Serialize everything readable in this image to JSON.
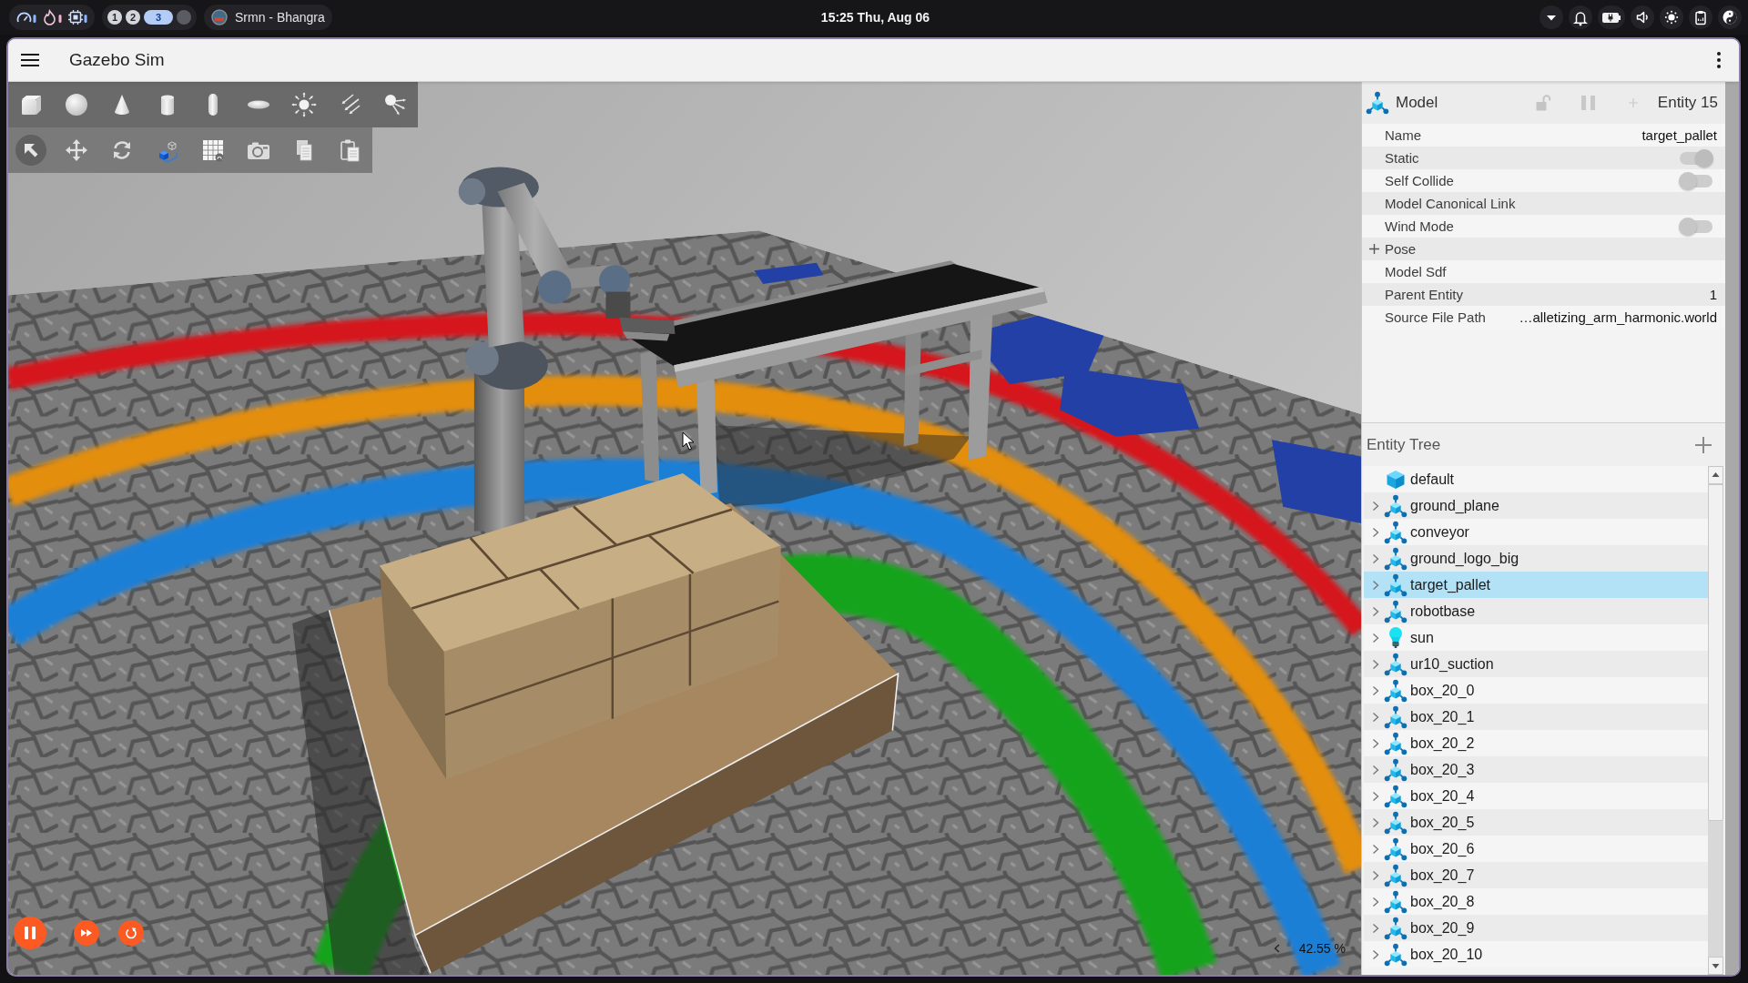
{
  "system_bar": {
    "workspaces": [
      {
        "label": "1",
        "kind": "occupied",
        "selected": false
      },
      {
        "label": "2",
        "kind": "occupied",
        "selected": false
      },
      {
        "label": "3",
        "kind": "occupied",
        "selected": true
      },
      {
        "kind": "empty",
        "selected": false
      }
    ],
    "media": {
      "title": "Srmn - Bhangra"
    },
    "clock": "15:25 Thu, Aug 06"
  },
  "window": {
    "title": "Gazebo Sim"
  },
  "viewport": {
    "transform_modes": [
      {
        "selected": true
      },
      {
        "selected": false
      },
      {
        "selected": false
      }
    ],
    "playback": {
      "running": true
    },
    "real_time_factor": "42.55 %"
  },
  "model_panel": {
    "title": "Model",
    "entity": "Entity 15",
    "properties": [
      {
        "label": "Name",
        "kind": "text",
        "value": "target_pallet"
      },
      {
        "label": "Static",
        "kind": "toggle",
        "on": true
      },
      {
        "label": "Self Collide",
        "kind": "toggle",
        "on": false
      },
      {
        "label": "Model Canonical Link",
        "kind": "text"
      },
      {
        "label": "Wind Mode",
        "kind": "toggle",
        "on": false
      },
      {
        "label": "Pose",
        "kind": "group",
        "expanded": false
      },
      {
        "label": "Model Sdf",
        "kind": "text"
      },
      {
        "label": "Parent Entity",
        "kind": "text",
        "value": "1"
      },
      {
        "label": "Source File Path",
        "kind": "text",
        "value": "…alletizing_arm_harmonic.world"
      }
    ]
  },
  "entity_tree": {
    "title": "Entity Tree",
    "items": [
      {
        "name": "default",
        "kind": "world",
        "selected": false
      },
      {
        "name": "ground_plane",
        "kind": "model",
        "expanded": false,
        "selected": false
      },
      {
        "name": "conveyor",
        "kind": "model",
        "expanded": false,
        "selected": false
      },
      {
        "name": "ground_logo_big",
        "kind": "model",
        "expanded": false,
        "selected": false
      },
      {
        "name": "target_pallet",
        "kind": "model",
        "expanded": false,
        "selected": true
      },
      {
        "name": "robotbase",
        "kind": "model",
        "expanded": false,
        "selected": false
      },
      {
        "name": "sun",
        "kind": "light",
        "expanded": false,
        "selected": false
      },
      {
        "name": "ur10_suction",
        "kind": "model",
        "expanded": false,
        "selected": false
      },
      {
        "name": "box_20_0",
        "kind": "model",
        "expanded": false,
        "selected": false
      },
      {
        "name": "box_20_1",
        "kind": "model",
        "expanded": false,
        "selected": false
      },
      {
        "name": "box_20_2",
        "kind": "model",
        "expanded": false,
        "selected": false
      },
      {
        "name": "box_20_3",
        "kind": "model",
        "expanded": false,
        "selected": false
      },
      {
        "name": "box_20_4",
        "kind": "model",
        "expanded": false,
        "selected": false
      },
      {
        "name": "box_20_5",
        "kind": "model",
        "expanded": false,
        "selected": false
      },
      {
        "name": "box_20_6",
        "kind": "model",
        "expanded": false,
        "selected": false
      },
      {
        "name": "box_20_7",
        "kind": "model",
        "expanded": false,
        "selected": false
      },
      {
        "name": "box_20_8",
        "kind": "model",
        "expanded": false,
        "selected": false
      },
      {
        "name": "box_20_9",
        "kind": "model",
        "expanded": false,
        "selected": false
      },
      {
        "name": "box_20_10",
        "kind": "model",
        "expanded": false,
        "selected": false
      }
    ]
  }
}
